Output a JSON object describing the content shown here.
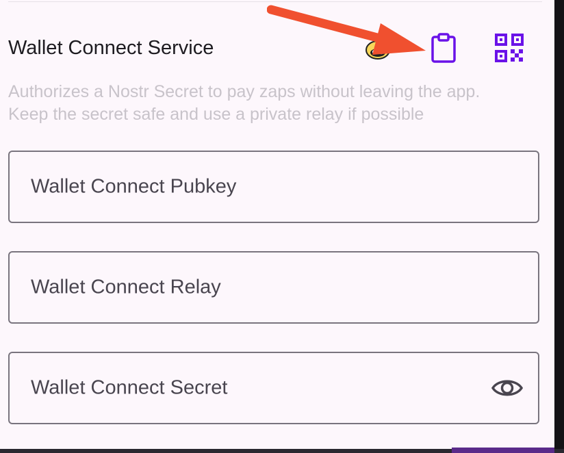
{
  "section": {
    "title": "Wallet Connect Service",
    "description_line1": "Authorizes a Nostr Secret to pay zaps without leaving the app.",
    "description_line2": "Keep the secret safe and use a private relay if possible"
  },
  "actions": {
    "alby_icon": "alby-logo-icon",
    "paste_icon": "clipboard-icon",
    "qr_icon": "qr-code-icon"
  },
  "fields": {
    "pubkey": {
      "label": "Wallet Connect Pubkey",
      "value": ""
    },
    "relay": {
      "label": "Wallet Connect Relay",
      "value": ""
    },
    "secret": {
      "label": "Wallet Connect Secret",
      "value": "",
      "visibility_icon": "eye-icon"
    }
  },
  "colors": {
    "accent": "#6a12e8",
    "annotation_arrow": "#f0502f",
    "background": "#fdf7fc",
    "outline": "#79747e"
  }
}
